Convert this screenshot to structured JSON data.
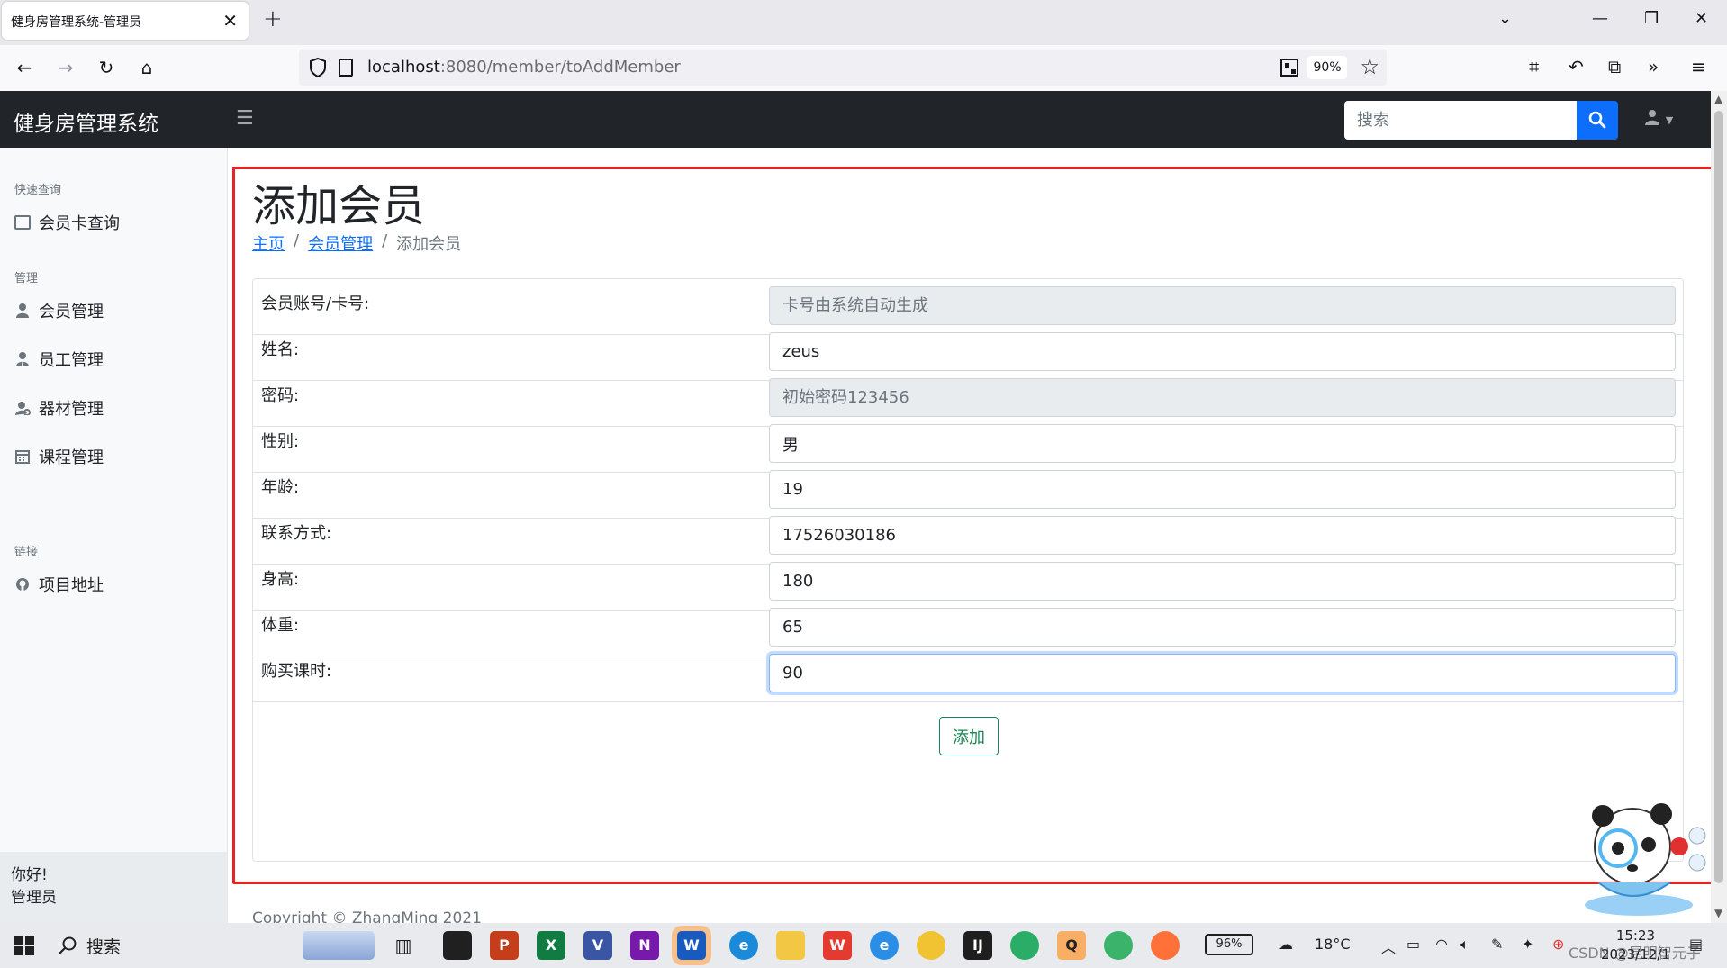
{
  "browser": {
    "tab_title": "健身房管理系统-管理员",
    "url_host": "localhost",
    "url_rest": ":8080/member/toAddMember",
    "zoom": "90%"
  },
  "app": {
    "brand": "健身房管理系统",
    "search_placeholder": "搜索"
  },
  "sidebar": {
    "sections": [
      {
        "heading": "快速查询",
        "items": [
          {
            "label": "会员卡查询",
            "icon": "id-card-icon"
          }
        ]
      },
      {
        "heading": "管理",
        "items": [
          {
            "label": "会员管理",
            "icon": "user-icon"
          },
          {
            "label": "员工管理",
            "icon": "user-tie-icon"
          },
          {
            "label": "器材管理",
            "icon": "equipment-icon"
          },
          {
            "label": "课程管理",
            "icon": "calendar-icon"
          }
        ]
      },
      {
        "heading": "链接",
        "items": [
          {
            "label": "项目地址",
            "icon": "github-icon"
          }
        ]
      }
    ],
    "footer_greeting": "你好!",
    "footer_role": "管理员"
  },
  "page": {
    "title": "添加会员",
    "breadcrumb": [
      "主页",
      "会员管理",
      "添加会员"
    ]
  },
  "form": {
    "rows": [
      {
        "label": "会员账号/卡号:",
        "value": "",
        "placeholder": "卡号由系统自动生成",
        "disabled": true
      },
      {
        "label": "姓名:",
        "value": "zeus",
        "placeholder": "",
        "disabled": false
      },
      {
        "label": "密码:",
        "value": "",
        "placeholder": "初始密码123456",
        "disabled": true
      },
      {
        "label": "性别:",
        "value": "男",
        "placeholder": "",
        "disabled": false
      },
      {
        "label": "年龄:",
        "value": "19",
        "placeholder": "",
        "disabled": false
      },
      {
        "label": "联系方式:",
        "value": "17526030186",
        "placeholder": "",
        "disabled": false
      },
      {
        "label": "身高:",
        "value": "180",
        "placeholder": "",
        "disabled": false
      },
      {
        "label": "体重:",
        "value": "65",
        "placeholder": "",
        "disabled": false
      },
      {
        "label": "购买课时:",
        "value": "90",
        "placeholder": "",
        "disabled": false
      }
    ],
    "submit_label": "添加"
  },
  "footer": {
    "copyright": "Copyright © ZhangMing 2021"
  },
  "taskbar": {
    "search_label": "搜索",
    "battery": "96%",
    "temperature": "18°C",
    "time": "15:23",
    "date": "2023/12/1",
    "watermark": "CSDN @昆明智元子"
  },
  "colors": {
    "accent": "#0d6efd",
    "success": "#198754",
    "highlight_border": "#e62424",
    "navbar": "#212529"
  }
}
